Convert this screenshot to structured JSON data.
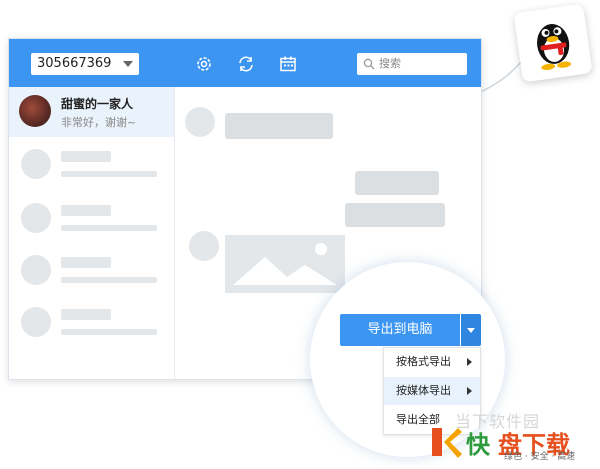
{
  "header": {
    "account": "305667369",
    "search_placeholder": "搜索"
  },
  "sidebar": {
    "selected_contact": {
      "name": "甜蜜的一家人",
      "last_message": "非常好，谢谢~"
    }
  },
  "export": {
    "button_label": "导出到电脑",
    "menu": [
      "按格式导出",
      "按媒体导出",
      "导出全部"
    ]
  },
  "watermark": {
    "site_text": "当下软件园",
    "brand_left": "快",
    "brand_right": "盘下载",
    "tagline": "绿色 · 安全 · 高速"
  },
  "colors": {
    "accent": "#3d95f2",
    "placeholder": "#e3e7ea",
    "bubble": "#dcdfe2"
  }
}
